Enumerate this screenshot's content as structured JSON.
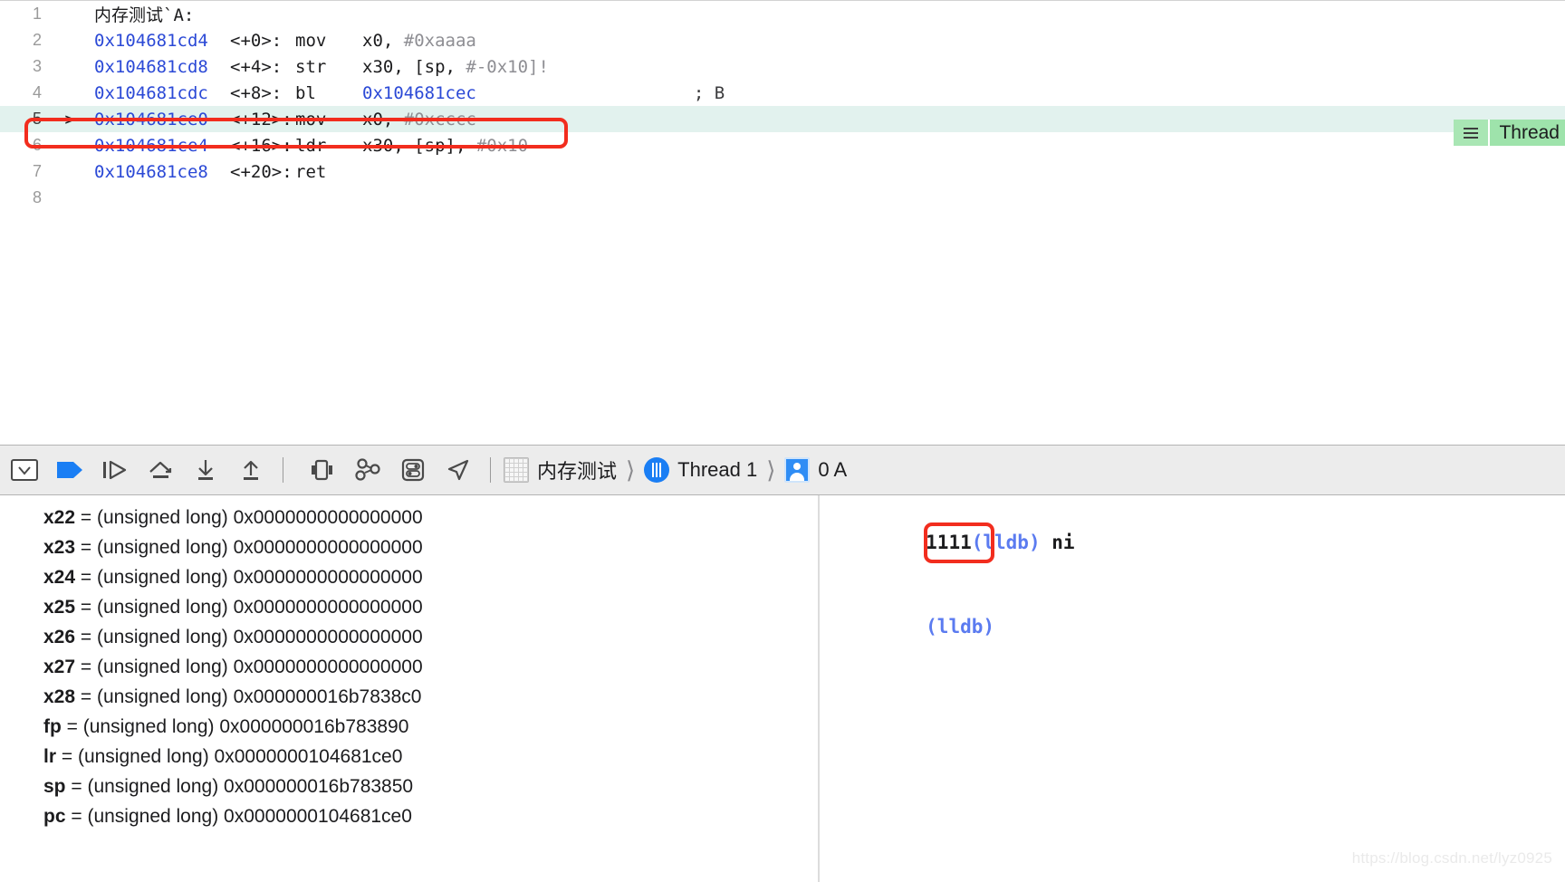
{
  "disassembly": {
    "header": "内存测试`A:",
    "lines": [
      {
        "num": "1",
        "arrow": "",
        "addr": "",
        "offset": "",
        "mnemonic": "",
        "operand": "",
        "imm": "",
        "comment": "",
        "header": "内存测试`A:",
        "is_header": true,
        "current": false
      },
      {
        "num": "2",
        "arrow": "",
        "addr": "0x104681cd4",
        "offset": "<+0>:",
        "mnemonic": "mov",
        "operand": "x0,",
        "imm": "#0xaaaa",
        "comment": "",
        "current": false
      },
      {
        "num": "3",
        "arrow": "",
        "addr": "0x104681cd8",
        "offset": "<+4>:",
        "mnemonic": "str",
        "operand": "x30, [sp,",
        "imm": "#-0x10]!",
        "comment": "",
        "current": false
      },
      {
        "num": "4",
        "arrow": "",
        "addr": "0x104681cdc",
        "offset": "<+8>:",
        "mnemonic": "bl",
        "operand": "",
        "imm": "",
        "target": "0x104681cec",
        "comment": "; B",
        "current": false
      },
      {
        "num": "5",
        "arrow": "->",
        "addr": "0x104681ce0",
        "offset": "<+12>:",
        "mnemonic": "mov",
        "operand": "x0,",
        "imm": "#0xcccc",
        "comment": "",
        "current": true
      },
      {
        "num": "6",
        "arrow": "",
        "addr": "0x104681ce4",
        "offset": "<+16>:",
        "mnemonic": "ldr",
        "operand": "x30, [sp],",
        "imm": "#0x10",
        "comment": "",
        "current": false
      },
      {
        "num": "7",
        "arrow": "",
        "addr": "0x104681ce8",
        "offset": "<+20>:",
        "mnemonic": "ret",
        "operand": "",
        "imm": "",
        "comment": "",
        "current": false
      },
      {
        "num": "8",
        "arrow": "",
        "addr": "",
        "offset": "",
        "mnemonic": "",
        "operand": "",
        "imm": "",
        "comment": "",
        "current": false
      }
    ],
    "thread_badge": "Thread"
  },
  "debug_bar": {
    "buttons": [
      {
        "name": "hide-debug-area-button",
        "label": "Hide Debug Area"
      },
      {
        "name": "continue-button",
        "label": "Continue"
      },
      {
        "name": "step-over-button",
        "label": "Step Over"
      },
      {
        "name": "step-into-button",
        "label": "Step Into"
      },
      {
        "name": "step-out-down-button",
        "label": "Step Out"
      },
      {
        "name": "step-out-up-button",
        "label": "Step Up"
      },
      {
        "name": "view-debugging-button",
        "label": "Debug View Hierarchy"
      },
      {
        "name": "memory-graph-button",
        "label": "Debug Memory Graph"
      },
      {
        "name": "environment-overrides-button",
        "label": "Environment Overrides"
      },
      {
        "name": "simulate-location-button",
        "label": "Simulate Location"
      }
    ],
    "breadcrumb": {
      "process": "内存测试",
      "thread": "Thread 1",
      "frame": "0 A"
    }
  },
  "variables": {
    "rows": [
      {
        "name": "x22",
        "rest": " = (unsigned long) 0x0000000000000000"
      },
      {
        "name": "x23",
        "rest": " = (unsigned long) 0x0000000000000000"
      },
      {
        "name": "x24",
        "rest": " = (unsigned long) 0x0000000000000000"
      },
      {
        "name": "x25",
        "rest": " = (unsigned long) 0x0000000000000000"
      },
      {
        "name": "x26",
        "rest": " = (unsigned long) 0x0000000000000000"
      },
      {
        "name": "x27",
        "rest": " = (unsigned long) 0x0000000000000000"
      },
      {
        "name": "x28",
        "rest": " = (unsigned long) 0x000000016b7838c0"
      },
      {
        "name": "fp",
        "rest": " = (unsigned long) 0x000000016b783890"
      },
      {
        "name": "lr",
        "rest": " = (unsigned long) 0x0000000104681ce0"
      },
      {
        "name": "sp",
        "rest": " = (unsigned long) 0x000000016b783850"
      },
      {
        "name": "pc",
        "rest": " = (unsigned long) 0x0000000104681ce0"
      }
    ]
  },
  "console": {
    "line1_count": "1111",
    "line1_prompt": "(lldb)",
    "line1_command": " ni",
    "line2_prompt": "(lldb)"
  },
  "annotations": {
    "highlight_color": "#f22d1e",
    "current_line_bg": "#e2f2ee",
    "thread_badge_color": "#9ee3ab",
    "address_color": "#2b49d6",
    "prompt_color": "#5b7bf0"
  },
  "watermark": "https://blog.csdn.net/lyz0925"
}
